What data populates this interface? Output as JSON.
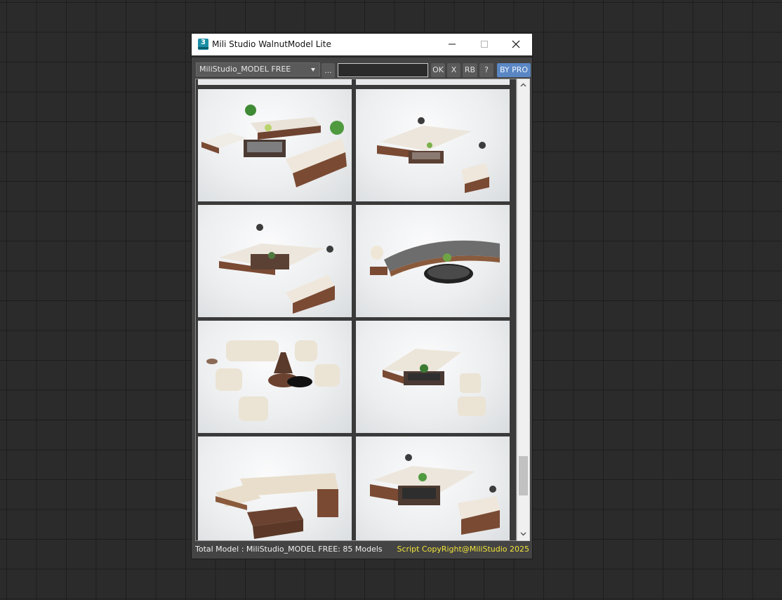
{
  "window": {
    "title": "Mili Studio WalnutModel Lite",
    "app_icon_glyph": "3"
  },
  "toolbar": {
    "library_selected": "MiliStudio_MODEL FREE",
    "browse_label": "...",
    "search_value": "",
    "ok_label": "OK",
    "x_label": "X",
    "rb_label": "RB",
    "help_label": "?",
    "pro_label": "BY PRO"
  },
  "gallery": {
    "items": [
      {
        "icon": "walnut-sofa-set-thumbnail"
      },
      {
        "icon": "walnut-sofa-set-thumbnail"
      },
      {
        "icon": "walnut-sofa-set-thumbnail"
      },
      {
        "icon": "curved-sofa-set-thumbnail"
      },
      {
        "icon": "armchair-set-thumbnail"
      },
      {
        "icon": "corner-sofa-set-thumbnail"
      },
      {
        "icon": "chaise-sofa-thumbnail"
      },
      {
        "icon": "walnut-sofa-set-thumbnail"
      }
    ],
    "scroll_position": 0.9
  },
  "status": {
    "total_text": "Total Model : MiliStudio_MODEL FREE: 85 Models",
    "copyright_text": "Script CopyRight@MiliStudio 2025"
  },
  "colors": {
    "pro_button": "#5a87c4",
    "copyright_text": "#f2e43a",
    "panel_bg": "#444444"
  }
}
